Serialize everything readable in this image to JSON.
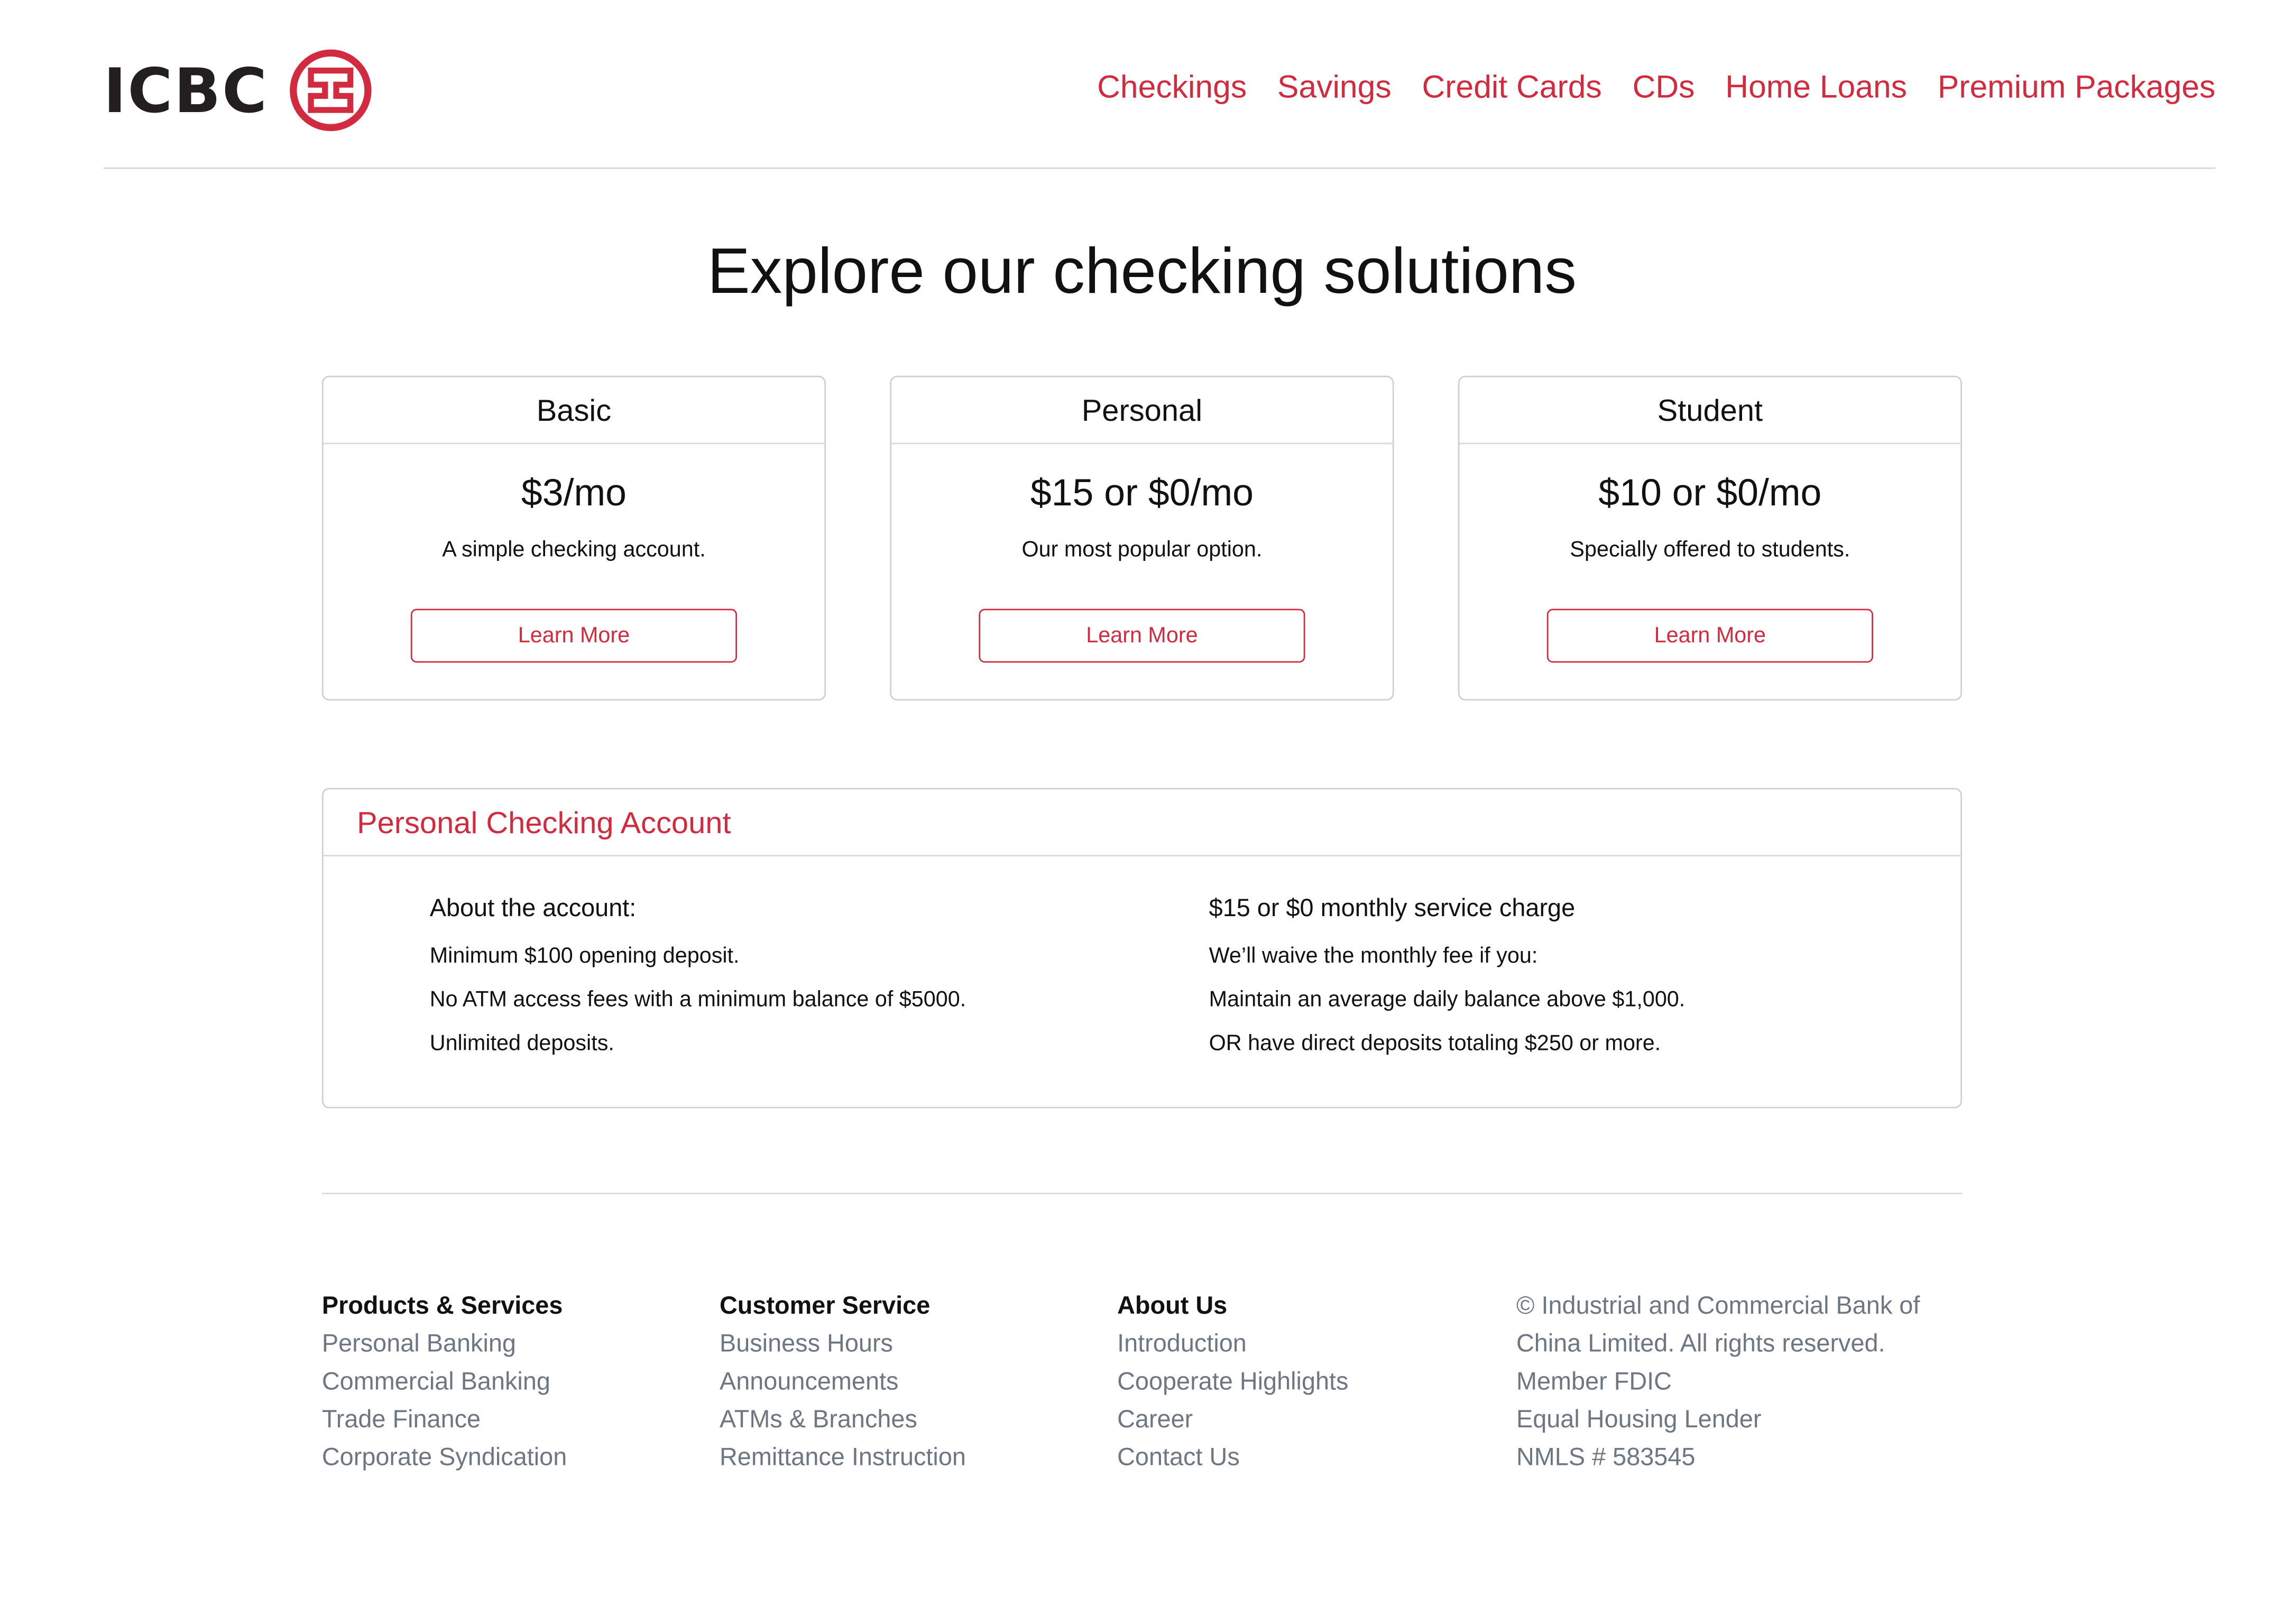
{
  "brand": {
    "name": "ICBC",
    "color": "#d22a3e"
  },
  "nav": [
    {
      "label": "Checkings"
    },
    {
      "label": "Savings"
    },
    {
      "label": "Credit Cards"
    },
    {
      "label": "CDs"
    },
    {
      "label": "Home Loans"
    },
    {
      "label": "Premium Packages"
    }
  ],
  "hero": {
    "title": "Explore our checking solutions"
  },
  "plans": [
    {
      "name": "Basic",
      "price": "$3/mo",
      "description": "A simple checking account.",
      "button": "Learn More"
    },
    {
      "name": "Personal",
      "price": "$15 or $0/mo",
      "description": "Our most popular option.",
      "button": "Learn More"
    },
    {
      "name": "Student",
      "price": "$10 or $0/mo",
      "description": "Specially offered to students.",
      "button": "Learn More"
    }
  ],
  "detail": {
    "title": "Personal Checking Account",
    "left": {
      "heading": "About the account:",
      "lines": [
        "Minimum $100 opening deposit.",
        "No ATM access fees with a minimum balance of $5000.",
        "Unlimited deposits."
      ]
    },
    "right": {
      "heading": "$15 or $0 monthly service charge",
      "lines": [
        "We’ll waive the monthly fee if you:",
        "Maintain an average daily balance above $1,000.",
        "OR have direct deposits totaling $250 or more."
      ]
    }
  },
  "footer": {
    "columns": [
      {
        "heading": "Products & Services",
        "links": [
          "Personal Banking",
          "Commercial Banking",
          "Trade Finance",
          "Corporate Syndication"
        ]
      },
      {
        "heading": "Customer Service",
        "links": [
          "Business Hours",
          "Announcements",
          "ATMs & Branches",
          "Remittance Instruction"
        ]
      },
      {
        "heading": "About Us",
        "links": [
          "Introduction",
          "Cooperate Highlights",
          "Career",
          "Contact Us"
        ]
      }
    ],
    "legal": [
      "© Industrial and Commercial Bank of",
      "China Limited. All rights reserved.",
      "Member FDIC",
      "Equal Housing Lender",
      "NMLS # 583545"
    ]
  }
}
